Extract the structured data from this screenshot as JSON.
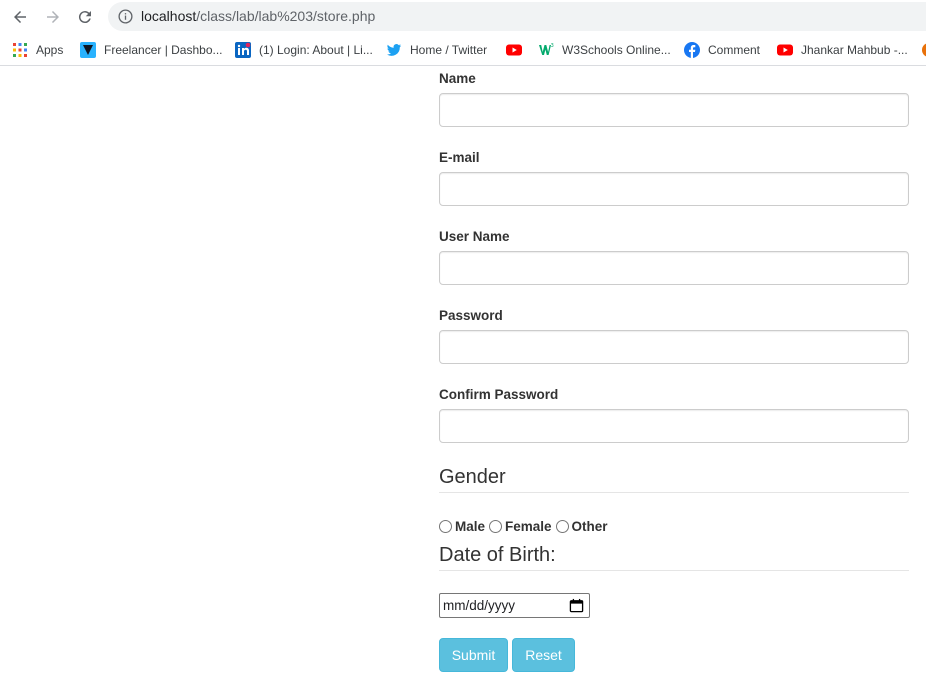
{
  "browser": {
    "url_host": "localhost",
    "url_path": "/class/lab/lab%203/store.php"
  },
  "bookmarks": [
    {
      "label": "Apps",
      "icon": "apps-grid-icon"
    },
    {
      "label": "Freelancer | Dashbo...",
      "icon": "freelancer-icon"
    },
    {
      "label": "(1) Login: About | Li...",
      "icon": "linkedin-icon"
    },
    {
      "label": "Home / Twitter",
      "icon": "twitter-icon"
    },
    {
      "label": "",
      "icon": "youtube-icon"
    },
    {
      "label": "W3Schools Online...",
      "icon": "w3schools-icon"
    },
    {
      "label": "Comment",
      "icon": "facebook-icon"
    },
    {
      "label": "Jhankar Mahbub -...",
      "icon": "youtube-icon"
    }
  ],
  "form": {
    "name_label": "Name",
    "email_label": "E-mail",
    "username_label": "User Name",
    "password_label": "Password",
    "confirm_label": "Confirm Password",
    "gender_legend": "Gender",
    "gender_options": [
      "Male",
      "Female",
      "Other"
    ],
    "dob_legend": "Date of Birth:",
    "dob_placeholder": "mm/dd/yyyy",
    "submit_label": "Submit",
    "reset_label": "Reset"
  },
  "colors": {
    "button_bg": "#5bc0de",
    "button_border": "#46b8da"
  }
}
